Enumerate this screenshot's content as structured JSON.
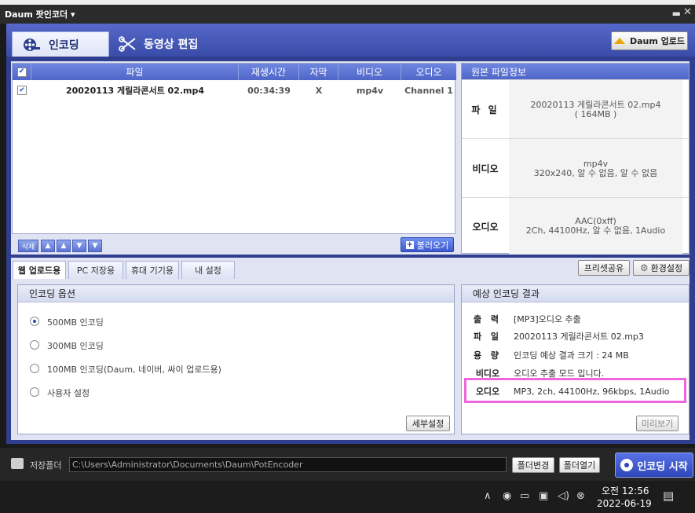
{
  "window": {
    "title": "Daum 팟인코더 ▾",
    "minimize": "▬",
    "close": "✕"
  },
  "main_tabs": [
    {
      "label": "인코딩",
      "icon": "film-reel-icon"
    },
    {
      "label": "동영상 편집",
      "icon": "scissors-icon"
    }
  ],
  "upload_button": "Daum 업로드",
  "file_list": {
    "columns": [
      "파일",
      "재생시간",
      "자막",
      "비디오",
      "오디오"
    ],
    "rows": [
      {
        "checked": true,
        "file": "20020113 게릴라콘서트 02.mp4",
        "duration": "00:34:39",
        "subtitle": "X",
        "video": "mp4v",
        "audio": "Channel 1"
      }
    ],
    "delete_label": "삭제",
    "load_label": "불러오기"
  },
  "source_info": {
    "title": "원본 파일정보",
    "rows": [
      {
        "label": "파 일",
        "line1": "20020113 게릴라콘서트 02.mp4",
        "line2": "( 164MB )"
      },
      {
        "label": "비디오",
        "line1": "mp4v",
        "line2": "320x240, 알 수 없음, 알 수 없음"
      },
      {
        "label": "오디오",
        "line1": "AAC(0xff)",
        "line2": "2Ch, 44100Hz, 알 수 없음, 1Audio"
      }
    ]
  },
  "sub_tabs": [
    "웹 업로드용",
    "PC 저장용",
    "휴대 기기용",
    "내 설정"
  ],
  "preset_share": "프리셋공유",
  "settings_button": "환경설정",
  "encoding_options": {
    "title": "인코딩 옵션",
    "options": [
      "500MB 인코딩",
      "300MB 인코딩",
      "100MB 인코딩(Daum, 네이버, 싸이 업로드용)",
      "사용자 설정"
    ],
    "selected_index": 0,
    "detail_button": "세부설정"
  },
  "result": {
    "title": "예상 인코딩 결과",
    "rows": [
      {
        "label": "출 력",
        "value": "[MP3]오디오 추출"
      },
      {
        "label": "파 일",
        "value": "20020113 게릴라콘서트 02.mp3"
      },
      {
        "label": "용 량",
        "value": "인코딩 예상 결과 크기 : 24 MB"
      },
      {
        "label": "비디오",
        "value": "오디오 추출 모드 입니다."
      },
      {
        "label": "오디오",
        "value": "MP3, 2ch, 44100Hz, 96kbps, 1Audio"
      }
    ],
    "preview_button": "미리보기"
  },
  "save_folder": {
    "label": "저장폴더",
    "path": "C:\\Users\\Administrator\\Documents\\Daum\\PotEncoder",
    "change_button": "폴더변경",
    "open_button": "폴더열기"
  },
  "start_button": "인코딩 시작",
  "taskbar": {
    "time": "오전 12:56",
    "date": "2022-06-19"
  },
  "colors": {
    "accent": "#3a4ca8",
    "highlight": "#ee66dd"
  }
}
